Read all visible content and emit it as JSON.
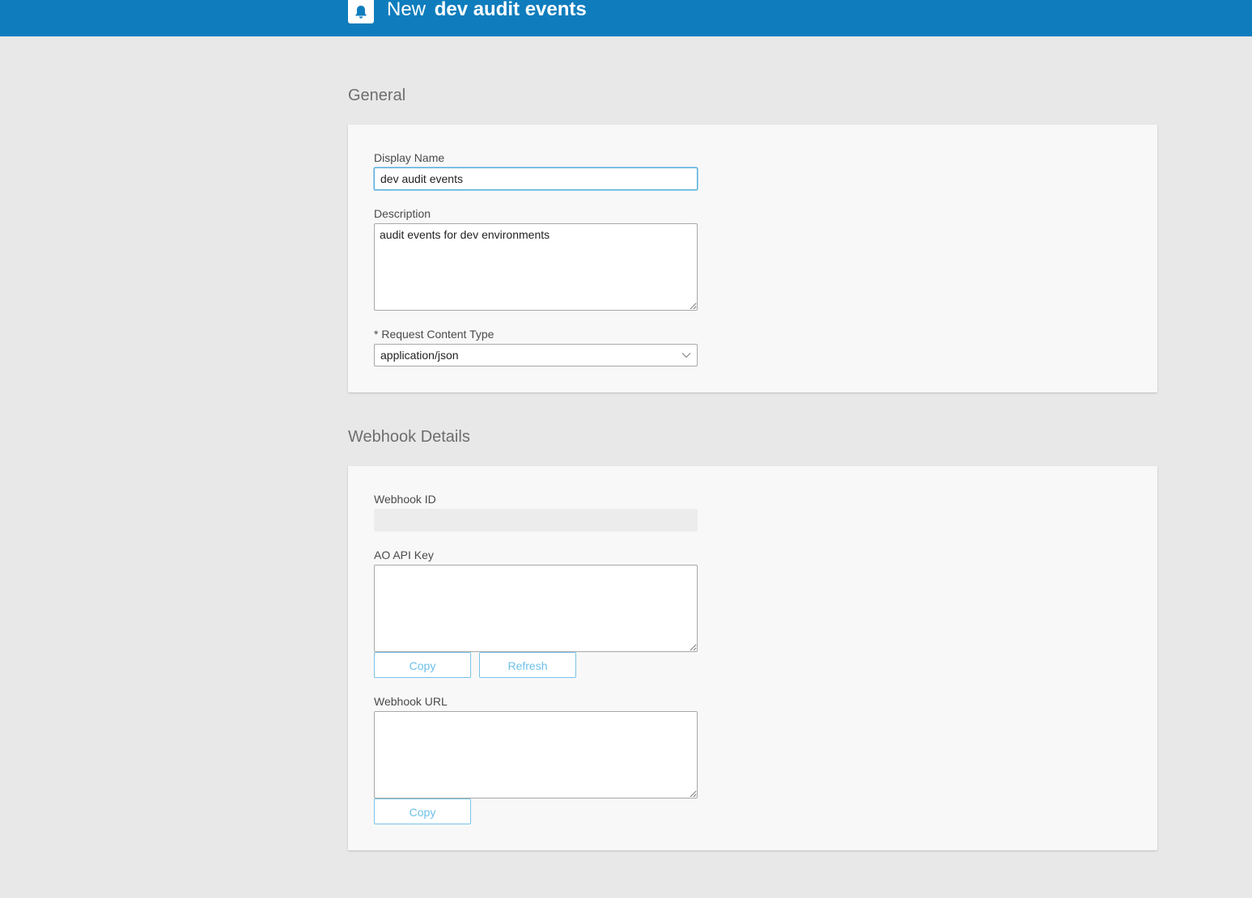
{
  "header": {
    "title_prefix": "New",
    "title_name": "dev audit events",
    "icon": "bell-icon"
  },
  "general": {
    "section_title": "General",
    "display_name": {
      "label": "Display Name",
      "value": "dev audit events"
    },
    "description": {
      "label": "Description",
      "value": "audit events for dev environments"
    },
    "content_type": {
      "label": "* Request Content Type",
      "value": "application/json"
    }
  },
  "webhook": {
    "section_title": "Webhook Details",
    "webhook_id": {
      "label": "Webhook ID",
      "value": ""
    },
    "api_key": {
      "label": "AO API Key",
      "value": "",
      "copy_label": "Copy",
      "refresh_label": "Refresh"
    },
    "url": {
      "label": "Webhook URL",
      "value": "",
      "copy_label": "Copy"
    }
  },
  "colors": {
    "header_bg": "#0f7dbd",
    "page_bg": "#e8e8e8",
    "button_accent": "#6cc0e8"
  }
}
